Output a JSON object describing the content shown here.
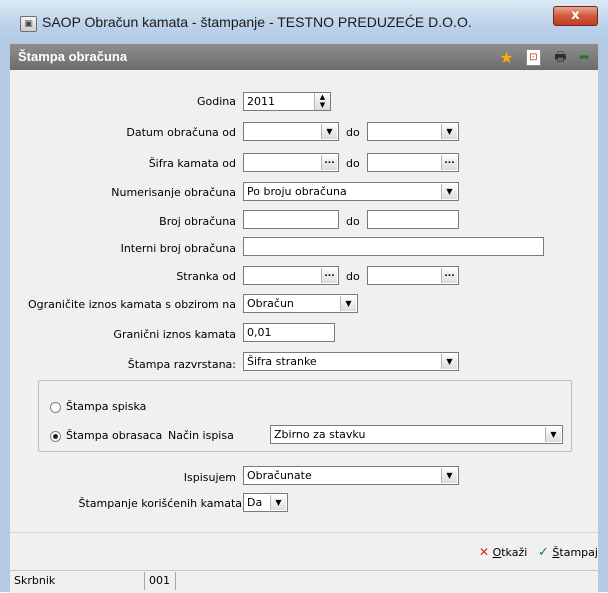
{
  "window": {
    "title": "SAOP Obračun kamata - štampanje - TESTNO PREDUZEĆE D.O.O.",
    "close_glyph": "x",
    "app_icon_glyph": "▣"
  },
  "panel": {
    "title": "Štampa obračuna",
    "toolbar": {
      "star_icon": "star-icon",
      "star_glyph": "★",
      "export_icon": "export-icon",
      "export_glyph": "⊡",
      "printer_icon": "printer-icon",
      "printer_glyph": "🖶",
      "exit_icon": "exit-icon",
      "exit_glyph": "➦"
    }
  },
  "form": {
    "godina": {
      "label": "Godina",
      "value": "2011"
    },
    "datum_obracuna": {
      "label": "Datum obračuna od",
      "from": "",
      "to_label": "do",
      "to": ""
    },
    "sifra_kamata": {
      "label": "Šifra kamata od",
      "from": "",
      "to_label": "do",
      "to": ""
    },
    "numerisanje": {
      "label": "Numerisanje obračuna",
      "value": "Po broju obračuna"
    },
    "broj_obracuna": {
      "label": "Broj obračuna",
      "from": "",
      "to_label": "do",
      "to": ""
    },
    "interni_broj": {
      "label": "Interni broj obračuna",
      "value": ""
    },
    "stranka": {
      "label": "Stranka od",
      "from": "",
      "to_label": "do",
      "to": ""
    },
    "ogranicite": {
      "label": "Ograničite iznos kamata s obzirom na",
      "value": "Obračun"
    },
    "granicni_iznos": {
      "label": "Granični iznos kamata",
      "value": "0,01"
    },
    "stampa_razvrstana": {
      "label": "Štampa razvrstana:",
      "value": "Šifra stranke"
    },
    "group": {
      "radio_spiska": "Štampa spiska",
      "radio_obrasca": "Štampa obrasaca",
      "nacin_label": "Način ispisa",
      "nacin_value": "Zbirno za stavku"
    },
    "ispisujem": {
      "label": "Ispisujem",
      "value": "Obračunate"
    },
    "stampanje_koriscenih": {
      "label": "Štampanje korišćenih kamata",
      "value": "Da"
    }
  },
  "footer": {
    "cancel_label": "Otkaži",
    "cancel_mnemonic": "O",
    "cancel_rest": "tkaži",
    "print_label": "Štampaj",
    "print_mnemonic": "Š",
    "print_rest": "tampaj",
    "cancel_glyph": "✕",
    "print_glyph": "✓"
  },
  "status": {
    "field1": "Skrbnik",
    "field2": "001"
  },
  "colors": {
    "accent_red": "#d02f1f",
    "accent_green": "#1f7d2a",
    "panel_header": "#7c7c7c"
  }
}
